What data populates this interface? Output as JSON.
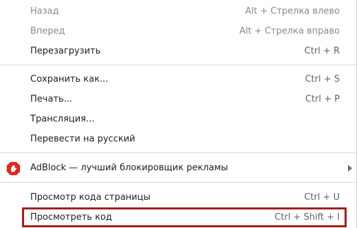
{
  "menu": {
    "items": [
      {
        "label": "Назад",
        "shortcut": "Alt + Стрелка влево",
        "disabled": true
      },
      {
        "label": "Вперед",
        "shortcut": "Alt + Стрелка вправо",
        "disabled": true
      },
      {
        "label": "Перезагрузить",
        "shortcut": "Ctrl + R",
        "disabled": false
      },
      {
        "label": "Сохранить как...",
        "shortcut": "Ctrl + S",
        "disabled": false
      },
      {
        "label": "Печать...",
        "shortcut": "Ctrl + P",
        "disabled": false
      },
      {
        "label": "Трансляция...",
        "shortcut": "",
        "disabled": false
      },
      {
        "label": "Перевести на русский",
        "shortcut": "",
        "disabled": false
      },
      {
        "label": "AdBlock — лучший блокировщик рекламы",
        "shortcut": "",
        "icon": "adblock-icon",
        "has_submenu": true
      },
      {
        "label": "Просмотр кода страницы",
        "shortcut": "Ctrl + U",
        "disabled": false
      },
      {
        "label": "Просмотреть код",
        "shortcut": "Ctrl + Shift + I",
        "disabled": false,
        "highlighted": true
      }
    ]
  },
  "colors": {
    "highlight_border": "#a31d1d",
    "adblock_red": "#e5261e",
    "disabled_text": "#8a8a8a"
  }
}
